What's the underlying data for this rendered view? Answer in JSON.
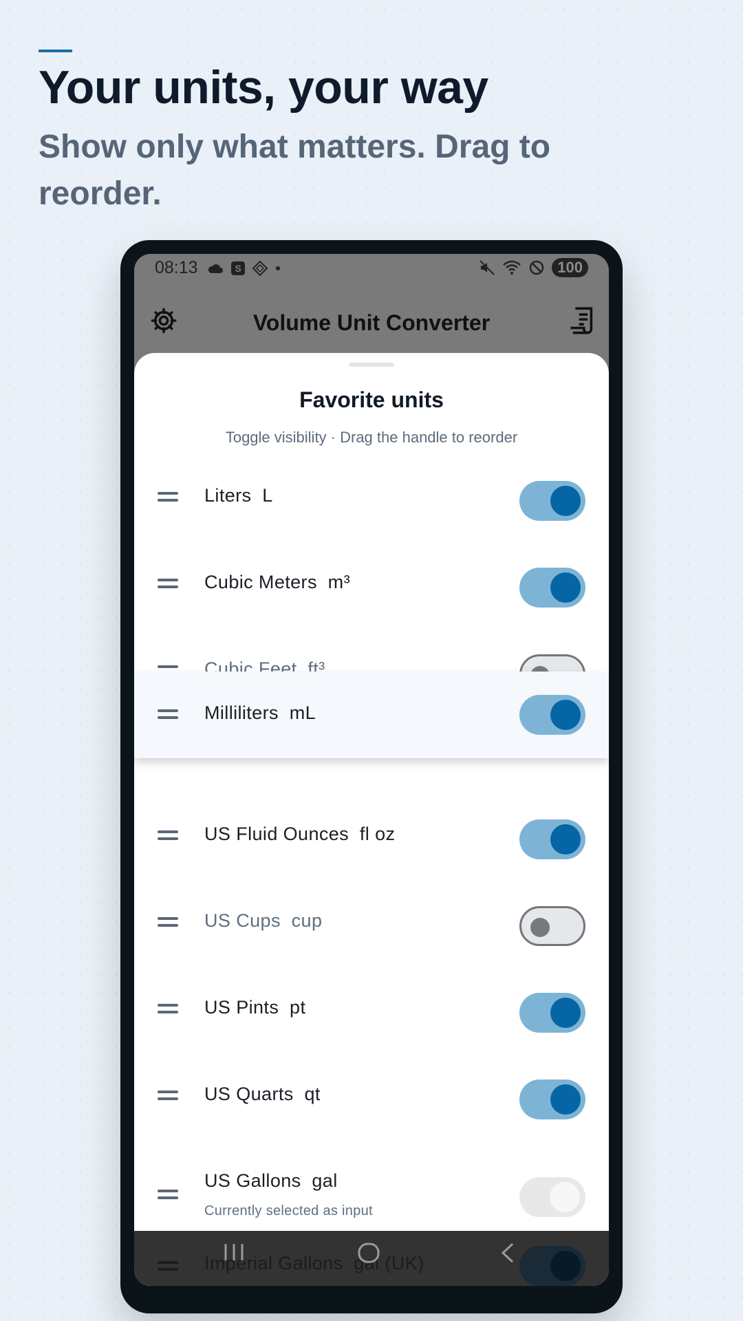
{
  "promo": {
    "headline": "Your units, your way",
    "subheadline": "Show only what matters. Drag to reorder."
  },
  "statusbar": {
    "time": "08:13",
    "battery": "100",
    "left_icons": [
      "cloud-icon",
      "s-app-icon",
      "diamond-icon",
      "dot-icon"
    ],
    "right_icons": [
      "mute-icon",
      "wifi-icon",
      "dnd-icon",
      "battery-icon"
    ]
  },
  "appbar": {
    "title": "Volume Unit Converter",
    "left_icon": "gear-icon",
    "right_icon": "report-icon"
  },
  "sheet": {
    "title": "Favorite units",
    "subtitle": "Toggle visibility · Drag the handle to reorder",
    "units": [
      {
        "name": "Liters",
        "symbol": "L",
        "state": "on"
      },
      {
        "name": "Cubic Meters",
        "symbol": "m³",
        "state": "on"
      },
      {
        "name": "Cubic Feet",
        "symbol": "ft³",
        "state": "off"
      },
      {
        "name": "Milliliters",
        "symbol": "mL",
        "state": "on",
        "dragging": true
      },
      {
        "name": "US Fluid Ounces",
        "symbol": "fl oz",
        "state": "on"
      },
      {
        "name": "US Cups",
        "symbol": "cup",
        "state": "off"
      },
      {
        "name": "US Pints",
        "symbol": "pt",
        "state": "on"
      },
      {
        "name": "US Quarts",
        "symbol": "qt",
        "state": "on"
      },
      {
        "name": "US Gallons",
        "symbol": "gal",
        "state": "disabled",
        "note": "Currently selected as input"
      },
      {
        "name": "Imperial Gallons",
        "symbol": "gal (UK)",
        "state": "on"
      }
    ]
  },
  "navbar": {
    "icons": [
      "recents-icon",
      "home-icon",
      "back-icon"
    ]
  },
  "colors": {
    "accent": "#0565a5",
    "toggle_track_on": "#7db4d6",
    "background": "#eaf0f7"
  }
}
